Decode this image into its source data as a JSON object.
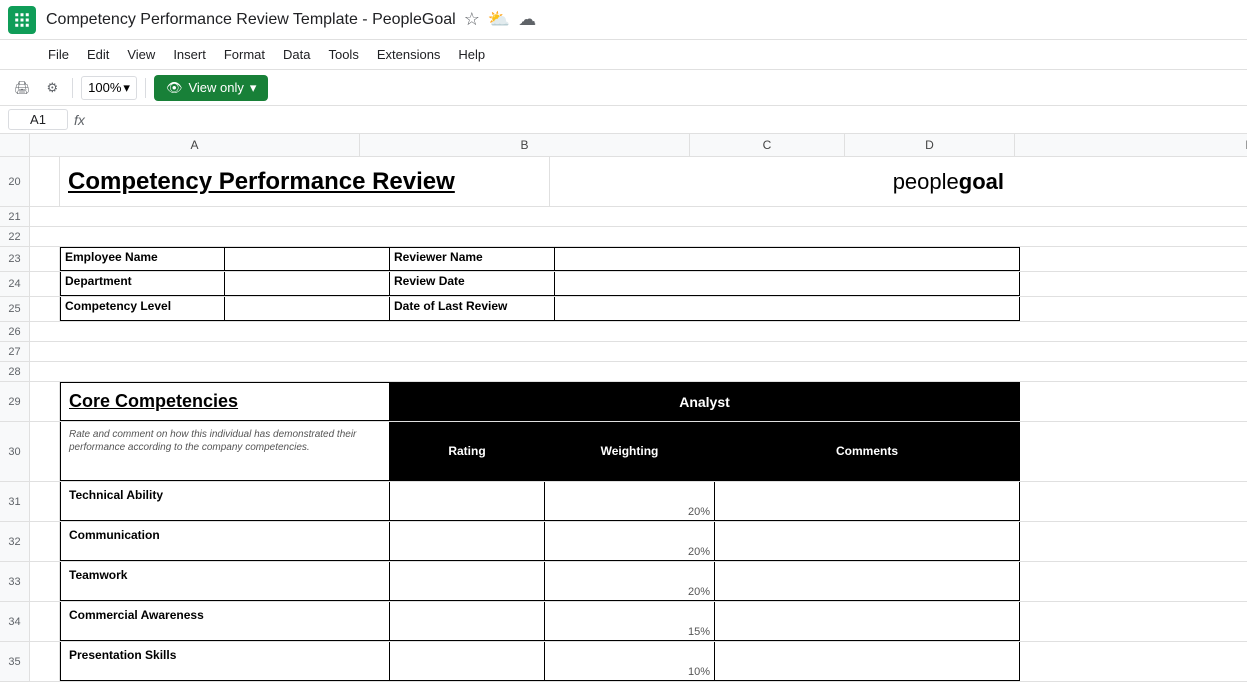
{
  "app": {
    "icon_color": "#0f9d58",
    "title": "Competency Performance Review Template - PeopleGoal",
    "menu_items": [
      "File",
      "Edit",
      "View",
      "Insert",
      "Format",
      "Data",
      "Tools",
      "Extensions",
      "Help"
    ],
    "zoom": "100%",
    "view_only_label": "View only",
    "cell_ref": "A1",
    "fx_label": "fx"
  },
  "columns": [
    {
      "label": "A",
      "id": "a"
    },
    {
      "label": "B",
      "id": "b"
    },
    {
      "label": "C",
      "id": "c"
    },
    {
      "label": "D",
      "id": "d"
    },
    {
      "label": "E",
      "id": "e"
    }
  ],
  "sheet": {
    "main_title": "Competency Performance Review",
    "logo_light": "people",
    "logo_bold": "goal",
    "info_rows": [
      {
        "label": "Employee Name",
        "value": "",
        "label2": "Reviewer Name",
        "value2": ""
      },
      {
        "label": "Department",
        "value": "",
        "label2": "Review Date",
        "value2": ""
      },
      {
        "label": "Competency Level",
        "value": "",
        "label2": "Date of Last Review",
        "value2": ""
      }
    ],
    "core_competencies_title": "Core Competencies",
    "analyst_label": "Analyst",
    "rate_comment": "Rate and comment on how this individual has demonstrated their performance according to the company competencies.",
    "col_headers": {
      "rating": "Rating",
      "weighting": "Weighting",
      "comments": "Comments"
    },
    "competencies": [
      {
        "name": "Technical Ability",
        "weighting": "20%"
      },
      {
        "name": "Communication",
        "weighting": "20%"
      },
      {
        "name": "Teamwork",
        "weighting": "20%"
      },
      {
        "name": "Commercial Awareness",
        "weighting": "15%"
      },
      {
        "name": "Presentation Skills",
        "weighting": "10%"
      }
    ],
    "row_numbers": [
      20,
      21,
      22,
      23,
      24,
      25,
      26,
      27,
      28,
      29,
      30,
      31,
      32,
      33,
      34,
      35
    ]
  }
}
